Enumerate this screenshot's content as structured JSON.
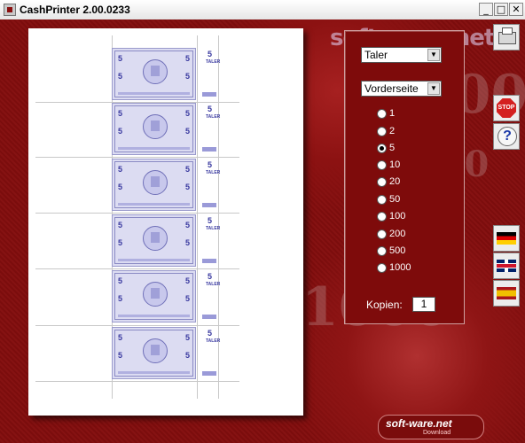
{
  "window": {
    "title": "CashPrinter  2.00.0233",
    "minimize_glyph": "_",
    "maximize_glyph": "□",
    "close_glyph": "✕"
  },
  "background": {
    "watermark": "soft-ware.net",
    "numbers": [
      "500",
      "1000"
    ]
  },
  "preview": {
    "notes": [
      {
        "value": "5",
        "stub_value": "5",
        "stub_text": "TALER"
      },
      {
        "value": "5",
        "stub_value": "5",
        "stub_text": "TALER"
      },
      {
        "value": "5",
        "stub_value": "5",
        "stub_text": "TALER"
      },
      {
        "value": "5",
        "stub_value": "5",
        "stub_text": "TALER"
      },
      {
        "value": "5",
        "stub_value": "5",
        "stub_text": "TALER"
      },
      {
        "value": "5",
        "stub_value": "5",
        "stub_text": "TALER"
      }
    ]
  },
  "controls": {
    "currency_select": "Taler",
    "side_select": "Vorderseite",
    "denominations": [
      {
        "label": "1",
        "checked": false
      },
      {
        "label": "2",
        "checked": false
      },
      {
        "label": "5",
        "checked": true
      },
      {
        "label": "10",
        "checked": false
      },
      {
        "label": "20",
        "checked": false
      },
      {
        "label": "50",
        "checked": false
      },
      {
        "label": "100",
        "checked": false
      },
      {
        "label": "200",
        "checked": false
      },
      {
        "label": "500",
        "checked": false
      },
      {
        "label": "1000",
        "checked": false
      }
    ],
    "copies_label": "Kopien:",
    "copies_value": "1"
  },
  "toolbar": {
    "stop_label": "STOP",
    "help_label": "?"
  },
  "branding": {
    "logo_text": "soft-ware.net",
    "logo_sub": "Download"
  },
  "colors": {
    "background": "#7a0c0c",
    "panel": "#7e0b0b",
    "banknote": "#dcdcf2",
    "banknote_ink": "#3a3aa0"
  }
}
